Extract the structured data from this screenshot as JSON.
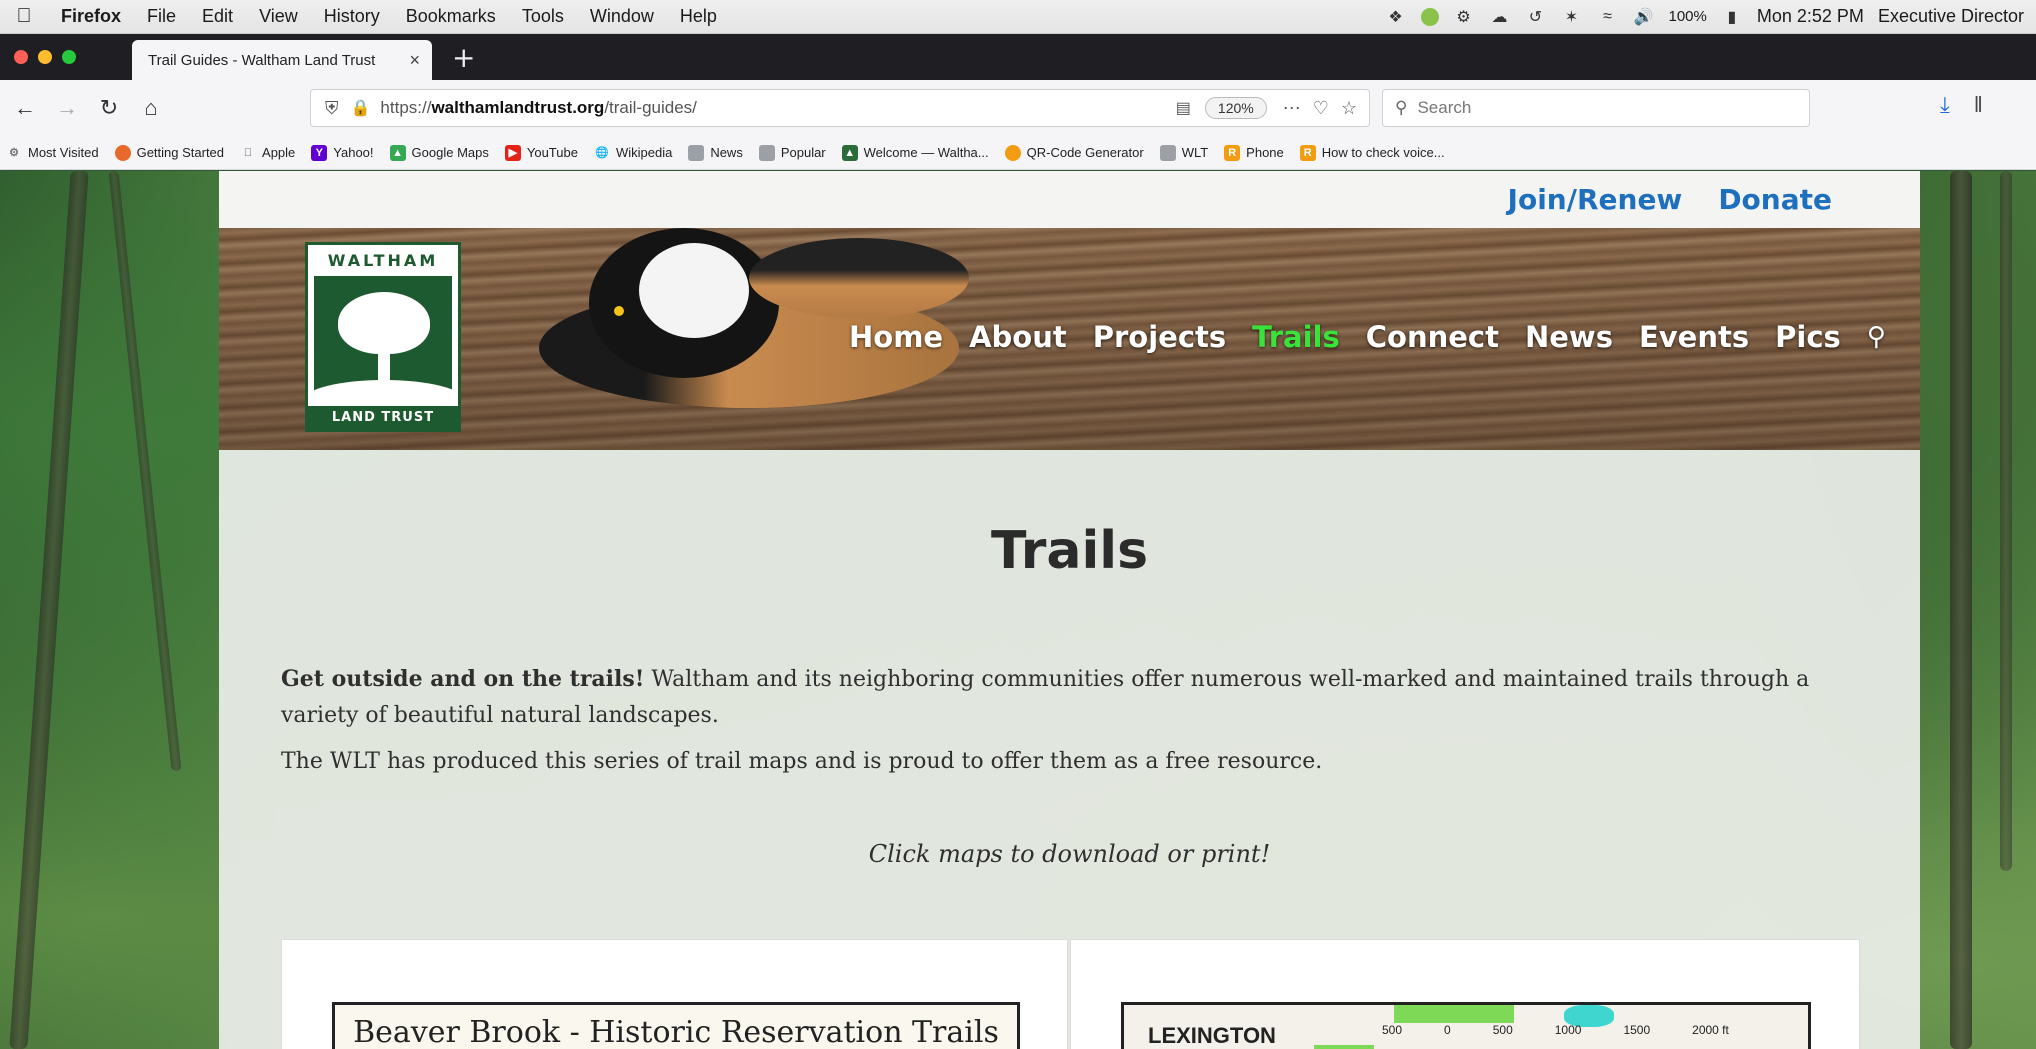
{
  "menubar": {
    "app": "Firefox",
    "items": [
      "File",
      "Edit",
      "View",
      "History",
      "Bookmarks",
      "Tools",
      "Window",
      "Help"
    ],
    "battery": "100%",
    "clock": "Mon 2:52 PM",
    "user": "Executive Director"
  },
  "tab": {
    "title": "Trail Guides - Waltham Land Trust",
    "close": "×",
    "new_tab": "+"
  },
  "navbar": {
    "url_prefix": "https://",
    "url_domain": "walthamlandtrust.org",
    "url_path": "/trail-guides/",
    "zoom": "120%",
    "search_placeholder": "Search"
  },
  "bookmarks": [
    {
      "label": "Most Visited",
      "icon": "gear-icon",
      "color": "#777777"
    },
    {
      "label": "Getting Started",
      "icon": "firefox-icon",
      "color": "#e8692b"
    },
    {
      "label": "Apple",
      "icon": "apple-icon",
      "color": "#555555"
    },
    {
      "label": "Yahoo!",
      "icon": "yahoo-icon",
      "color": "#5f01d1"
    },
    {
      "label": "Google Maps",
      "icon": "maps-icon",
      "color": "#34a853"
    },
    {
      "label": "YouTube",
      "icon": "youtube-icon",
      "color": "#e62117"
    },
    {
      "label": "Wikipedia",
      "icon": "globe-icon",
      "color": "#444444"
    },
    {
      "label": "News",
      "icon": "folder-icon",
      "color": "#9aa0a6"
    },
    {
      "label": "Popular",
      "icon": "folder-icon",
      "color": "#9aa0a6"
    },
    {
      "label": "Welcome — Waltha...",
      "icon": "site-icon",
      "color": "#2b6b3a"
    },
    {
      "label": "QR-Code Generator",
      "icon": "qr-icon",
      "color": "#f39c12"
    },
    {
      "label": "WLT",
      "icon": "folder-icon",
      "color": "#9aa0a6"
    },
    {
      "label": "Phone",
      "icon": "r-icon",
      "color": "#f39c12"
    },
    {
      "label": "How to check voice...",
      "icon": "r-icon",
      "color": "#f39c12"
    }
  ],
  "site": {
    "topbar": {
      "join": "Join/Renew",
      "donate": "Donate"
    },
    "logo": {
      "top": "WALTHAM",
      "bottom": "LAND TRUST"
    },
    "nav": [
      "Home",
      "About",
      "Projects",
      "Trails",
      "Connect",
      "News",
      "Events",
      "Pics"
    ],
    "active_nav": "Trails",
    "heading": "Trails",
    "intro_bold": "Get outside and on the trails!",
    "intro_rest": " Waltham and its neighboring communities offer numerous well-marked and maintained trails through a variety of beautiful natural landscapes.",
    "intro2": "The WLT has produced this series of trail maps and is proud to offer them as a free resource.",
    "hint": "Click maps to download or print!",
    "card1_title": "Beaver Brook - Historic Reservation Trails",
    "card2_place": "LEXINGTON",
    "card2_scale": [
      "500",
      "0",
      "500",
      "1000",
      "1500",
      "2000 ft"
    ]
  },
  "colors": {
    "link_blue": "#1f6fbf",
    "nav_active": "#39e33c",
    "logo_green": "#1e5a30"
  }
}
